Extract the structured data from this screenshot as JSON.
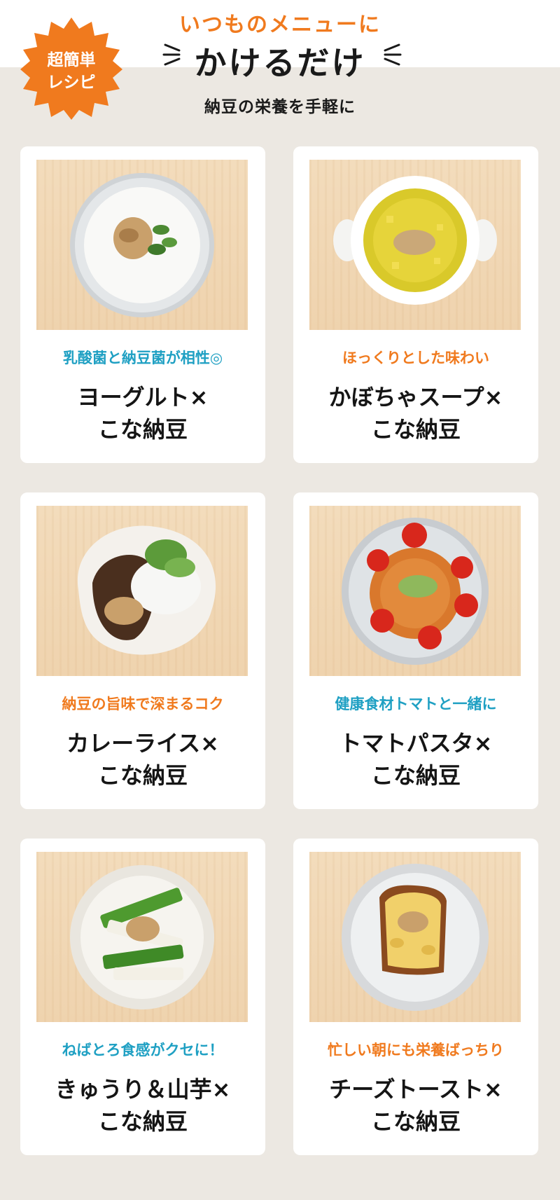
{
  "header": {
    "badge_line1": "超簡単",
    "badge_line2": "レシピ",
    "subtitle": "いつものメニューに",
    "title": "かけるだけ",
    "caption": "納豆の栄養を手軽に",
    "accent_orange": "#f07a1e",
    "accent_blue": "#1fa0c3"
  },
  "recipes": [
    {
      "tag": "乳酸菌と納豆菌が相性◎",
      "name1": "ヨーグルト×",
      "name2": "こな納豆",
      "photo": "yogurt-photo"
    },
    {
      "tag": "ほっくりとした味わい",
      "name1": "かぼちゃスープ×",
      "name2": "こな納豆",
      "photo": "pumpkin-soup-photo"
    },
    {
      "tag": "納豆の旨味で深まるコク",
      "name1": "カレーライス×",
      "name2": "こな納豆",
      "photo": "curry-rice-photo"
    },
    {
      "tag": "健康食材トマトと一緒に",
      "name1": "トマトパスタ×",
      "name2": "こな納豆",
      "photo": "tomato-pasta-photo"
    },
    {
      "tag": "ねばとろ食感がクセに！",
      "name1": "きゅうり＆山芋×",
      "name2": "こな納豆",
      "photo": "cucumber-yam-photo"
    },
    {
      "tag": "忙しい朝にも栄養ばっちり",
      "name1": "チーズトースト×",
      "name2": "こな納豆",
      "photo": "cheese-toast-photo"
    }
  ]
}
